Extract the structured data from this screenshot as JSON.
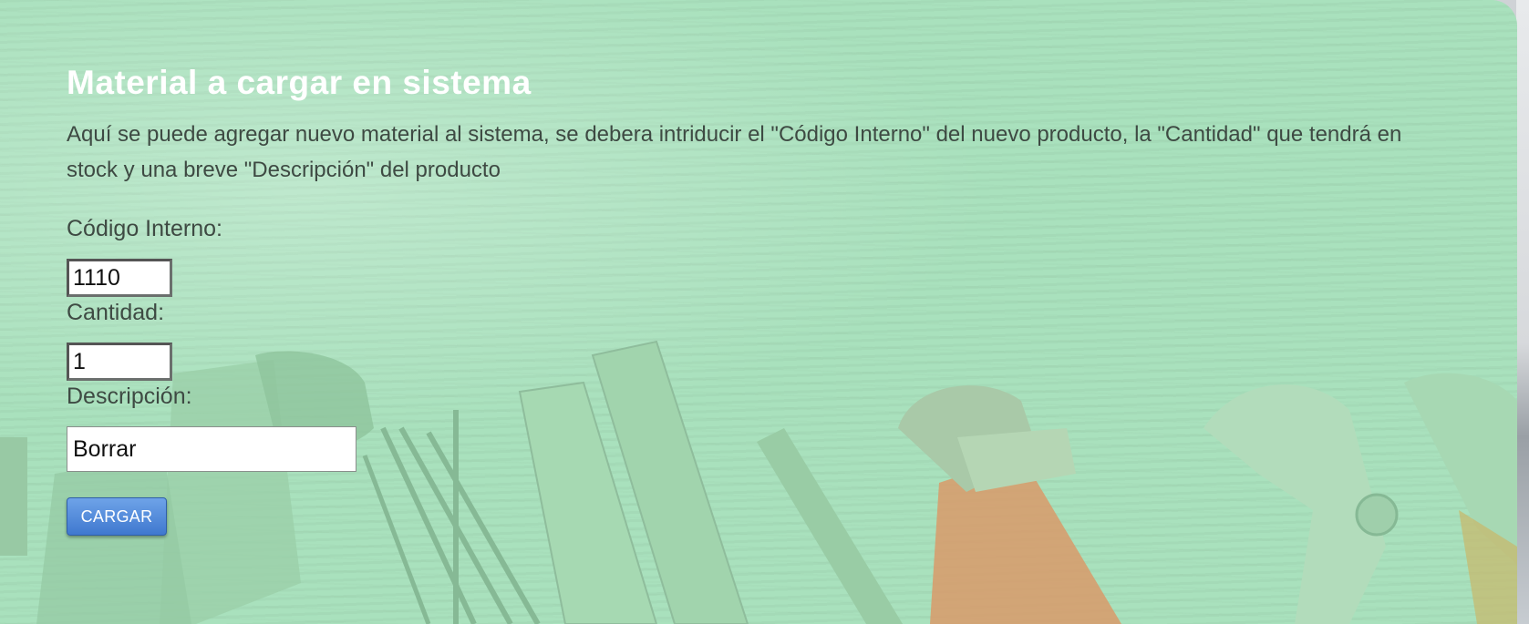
{
  "form": {
    "title": "Material a cargar en sistema",
    "intro": "Aquí se puede agregar nuevo material al sistema, se debera intriducir el \"Código Interno\" del nuevo producto, la \"Cantidad\" que tendrá en stock y una breve \"Descripción\" del producto",
    "codigo_label": "Código Interno:",
    "codigo_value": "1110",
    "cantidad_label": "Cantidad:",
    "cantidad_value": "1",
    "descripcion_label": "Descripción:",
    "descripcion_value": "Borrar",
    "submit_label": "CARGAR"
  },
  "colors": {
    "overlay_green": "#a9e1bd",
    "title_white": "#ffffff",
    "text_dark": "#3e4a43",
    "button_blue": "#3f78cf"
  }
}
